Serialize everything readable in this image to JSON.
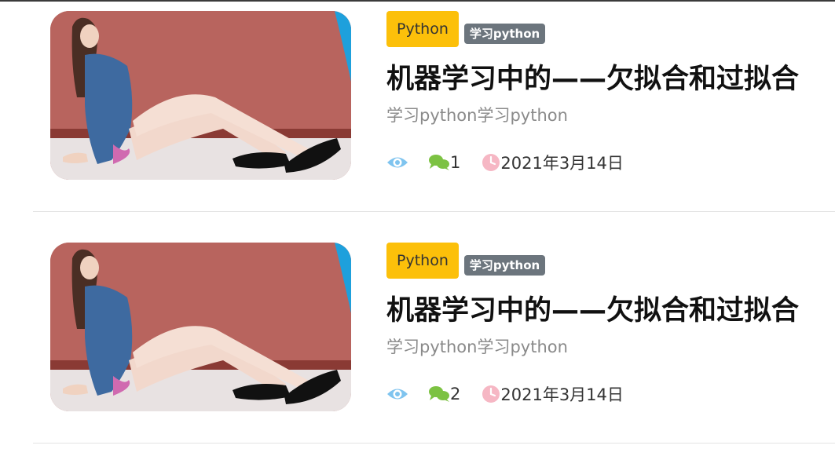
{
  "colors": {
    "category_badge_bg": "#fcc00a",
    "tag_badge_bg": "#6c757d",
    "views_icon": "#7fc4ef",
    "comments_icon": "#7cc242",
    "clock_icon": "#f6b7c4"
  },
  "posts": [
    {
      "thumbnail_icon": "photo-thumbnail",
      "category": "Python",
      "tag": "学习python",
      "title": "机器学习中的——欠拟合和过拟合",
      "excerpt": "学习python学习python",
      "comments": "1",
      "date": "2021年3月14日"
    },
    {
      "thumbnail_icon": "photo-thumbnail",
      "category": "Python",
      "tag": "学习python",
      "title": "机器学习中的——欠拟合和过拟合",
      "excerpt": "学习python学习python",
      "comments": "2",
      "date": "2021年3月14日"
    }
  ]
}
